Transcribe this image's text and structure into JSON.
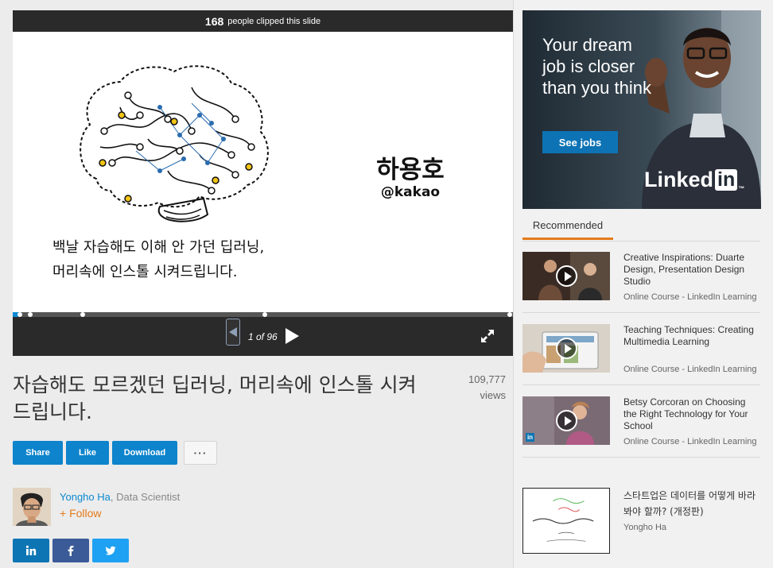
{
  "player": {
    "clip_count": "168",
    "clip_text": "people clipped this slide",
    "slide": {
      "name": "하용호",
      "handle": "@kakao",
      "subtitle_line1": "백날 자습해도 이해 안 가던 딥러닝,",
      "subtitle_line2": "머리속에 인스톨 시켜드립니다."
    },
    "page_indicator": "1 of 96",
    "progress": {
      "current": 1,
      "total": 96
    }
  },
  "presentation": {
    "title": "자습해도 모르겠던 딥러닝, 머리속에 인스톨 시켜드립니다.",
    "views_count": "109,777",
    "views_label": "views"
  },
  "actions": {
    "share": "Share",
    "like": "Like",
    "download": "Download",
    "more": "···"
  },
  "author": {
    "name": "Yongho Ha",
    "role": ", Data Scientist",
    "follow": "+ Follow"
  },
  "social": [
    "linkedin-icon",
    "facebook-icon",
    "twitter-icon"
  ],
  "ad": {
    "headline": "Your dream job is closer than you think",
    "cta": "See jobs",
    "brand_text": "Linked",
    "brand_box": "in",
    "brand_mark": "™"
  },
  "recommended": {
    "tab_label": "Recommended",
    "items": [
      {
        "title": "Creative Inspirations: Duarte Design, Presentation Design Studio",
        "meta": "Online Course - LinkedIn Learning"
      },
      {
        "title": "Teaching Techniques: Creating Multimedia Learning",
        "meta": "Online Course - LinkedIn Learning"
      },
      {
        "title": "Betsy Corcoran on Choosing the Right Technology for Your School",
        "meta": "Online Course - LinkedIn Learning"
      }
    ],
    "slide_item": {
      "title": "스타트업은 데이터를 어떻게 바라봐야 할까? (개정판)",
      "author": "Yongho Ha"
    }
  },
  "colors": {
    "accent_blue": "#0d84cc",
    "follow_orange": "#e37a1a",
    "player_dark": "#2a2a2a",
    "linkedin_blue": "#0d75b3"
  }
}
